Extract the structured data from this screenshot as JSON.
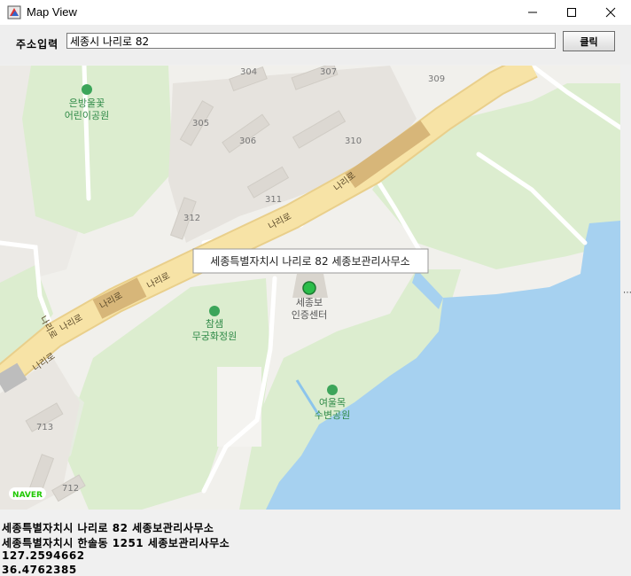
{
  "window": {
    "title": "Map View"
  },
  "toolbar": {
    "address_label": "주소입력",
    "address_value": "세종시 나리로 82",
    "click_label": "클릭"
  },
  "map": {
    "popup_text": "세종특별자치시 나리로 82 세종보관리사무소",
    "marker_label_line1": "세종보",
    "marker_label_line2": "인증센터",
    "road_label": "나리로",
    "provider_logo": "NAVER",
    "places": [
      {
        "line1": "은방울꽃",
        "line2": "어린이공원"
      },
      {
        "line1": "참샘",
        "line2": "무궁화정원"
      },
      {
        "line1": "여울목",
        "line2": "수변공원"
      }
    ],
    "building_numbers": [
      "304",
      "307",
      "309",
      "305",
      "306",
      "310",
      "311",
      "312",
      "713",
      "712"
    ],
    "colors": {
      "water": "#a6d1f0",
      "park": "#dcedcf",
      "road": "#f7e3a6",
      "marker": "#2bbd4a"
    }
  },
  "result": {
    "road_address": "세종특별자치시 나리로 82 세종보관리사무소",
    "jibun_address": "세종특별자치시 한솔동 1251 세종보관리사무소",
    "longitude": "127.2594662",
    "latitude": "36.4762385"
  }
}
